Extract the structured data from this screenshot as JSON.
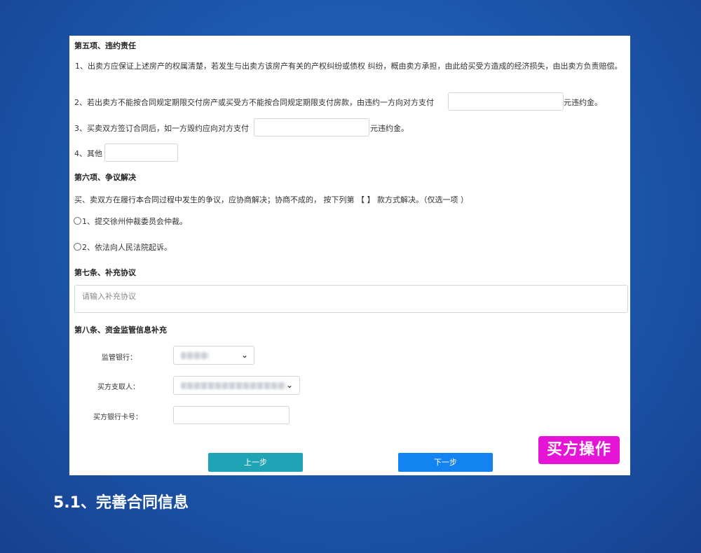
{
  "section5": {
    "title": "第五项、违约责任",
    "item1": "1、出卖方应保证上述房产的权属清楚，若发生与出卖方该房产有关的产权纠纷或债权 纠纷，概由卖方承担，由此给买受方造成的经济损失，由出卖方负责赔偿。",
    "item2_prefix": "2、若出卖方不能按合同规定期限交付房产或买受方不能按合同规定期限支付房款，由违约一方向对方支付",
    "item2_suffix": "元违约金。",
    "item3_prefix": "3、买卖双方签订合同后，如一方毁约应向对方支付",
    "item3_suffix": "元违约金。",
    "item4_label": "4、其他"
  },
  "section6": {
    "title": "第六项、争议解决",
    "text": "买、卖双方在履行本合同过程中发生的争议，应协商解决；协商不成的， 按下列第 【 】 款方式解决。（仅选一项 ）",
    "option1": "1、提交徐州仲裁委员会仲裁。",
    "option2": "2、依法向人民法院起诉。"
  },
  "section7": {
    "title": "第七条、补充协议",
    "placeholder": "请输入补充协议"
  },
  "section8": {
    "title": "第八条、资金监管信息补充",
    "bank_label": "监管银行：",
    "payee_label": "买方支取人：",
    "card_label": "买方银行卡号："
  },
  "buttons": {
    "prev": "上一步",
    "next": "下一步"
  },
  "badge": "买方操作",
  "caption": "5.1、完善合同信息",
  "colors": {
    "prev_button": "#1fa3b5",
    "next_button": "#1283f0",
    "badge": "#e614d6",
    "background": "#1d5ab0"
  }
}
